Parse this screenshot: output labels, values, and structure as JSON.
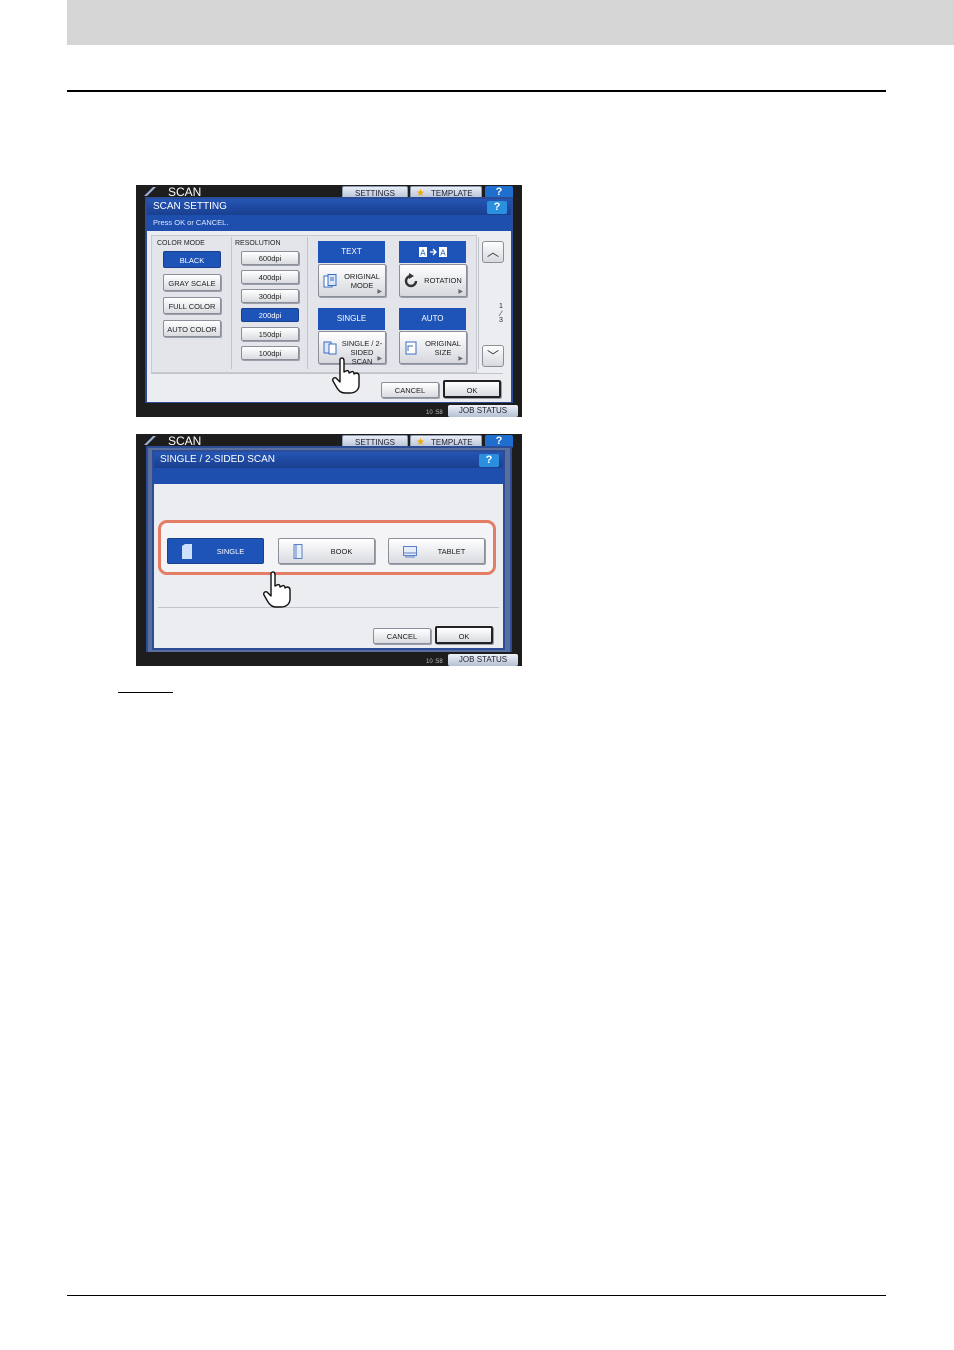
{
  "screen1": {
    "app_title": "SCAN",
    "tabs": {
      "settings": "SETTINGS",
      "template": "TEMPLATE"
    },
    "help": "?",
    "dialog_title": "SCAN SETTING",
    "message": "Press OK or CANCEL.",
    "color_mode": {
      "label": "COLOR MODE",
      "options": [
        "BLACK",
        "GRAY SCALE",
        "FULL COLOR",
        "AUTO COLOR"
      ],
      "selected": "BLACK"
    },
    "resolution": {
      "label": "RESOLUTION",
      "options": [
        "600dpi",
        "400dpi",
        "300dpi",
        "200dpi",
        "150dpi",
        "100dpi"
      ],
      "selected": "200dpi"
    },
    "functions": {
      "original_mode": {
        "value": "TEXT",
        "label_l1": "ORIGINAL",
        "label_l2": "MODE"
      },
      "rotation": {
        "label": "ROTATION"
      },
      "single_2sided": {
        "value": "SINGLE",
        "label_l1": "SINGLE / 2-",
        "label_l2": "SIDED SCAN"
      },
      "original_size": {
        "value": "AUTO",
        "label_l1": "ORIGINAL",
        "label_l2": "SIZE"
      }
    },
    "page": {
      "current": "1",
      "total": "3"
    },
    "cancel": "CANCEL",
    "ok": "OK",
    "time": "10 :58",
    "job_status": "JOB STATUS"
  },
  "screen2": {
    "app_title": "SCAN",
    "tabs": {
      "settings": "SETTINGS",
      "template": "TEMPLATE"
    },
    "help": "?",
    "dialog_title": "SINGLE / 2-SIDED SCAN",
    "choices": [
      "SINGLE",
      "BOOK",
      "TABLET"
    ],
    "selected": "SINGLE",
    "cancel": "CANCEL",
    "ok": "OK",
    "time": "10 :58",
    "job_status": "JOB STATUS"
  },
  "colors": {
    "accent_blue": "#1e53b8",
    "highlight_frame": "#e47d66",
    "header_band": "#d5d5d5"
  }
}
